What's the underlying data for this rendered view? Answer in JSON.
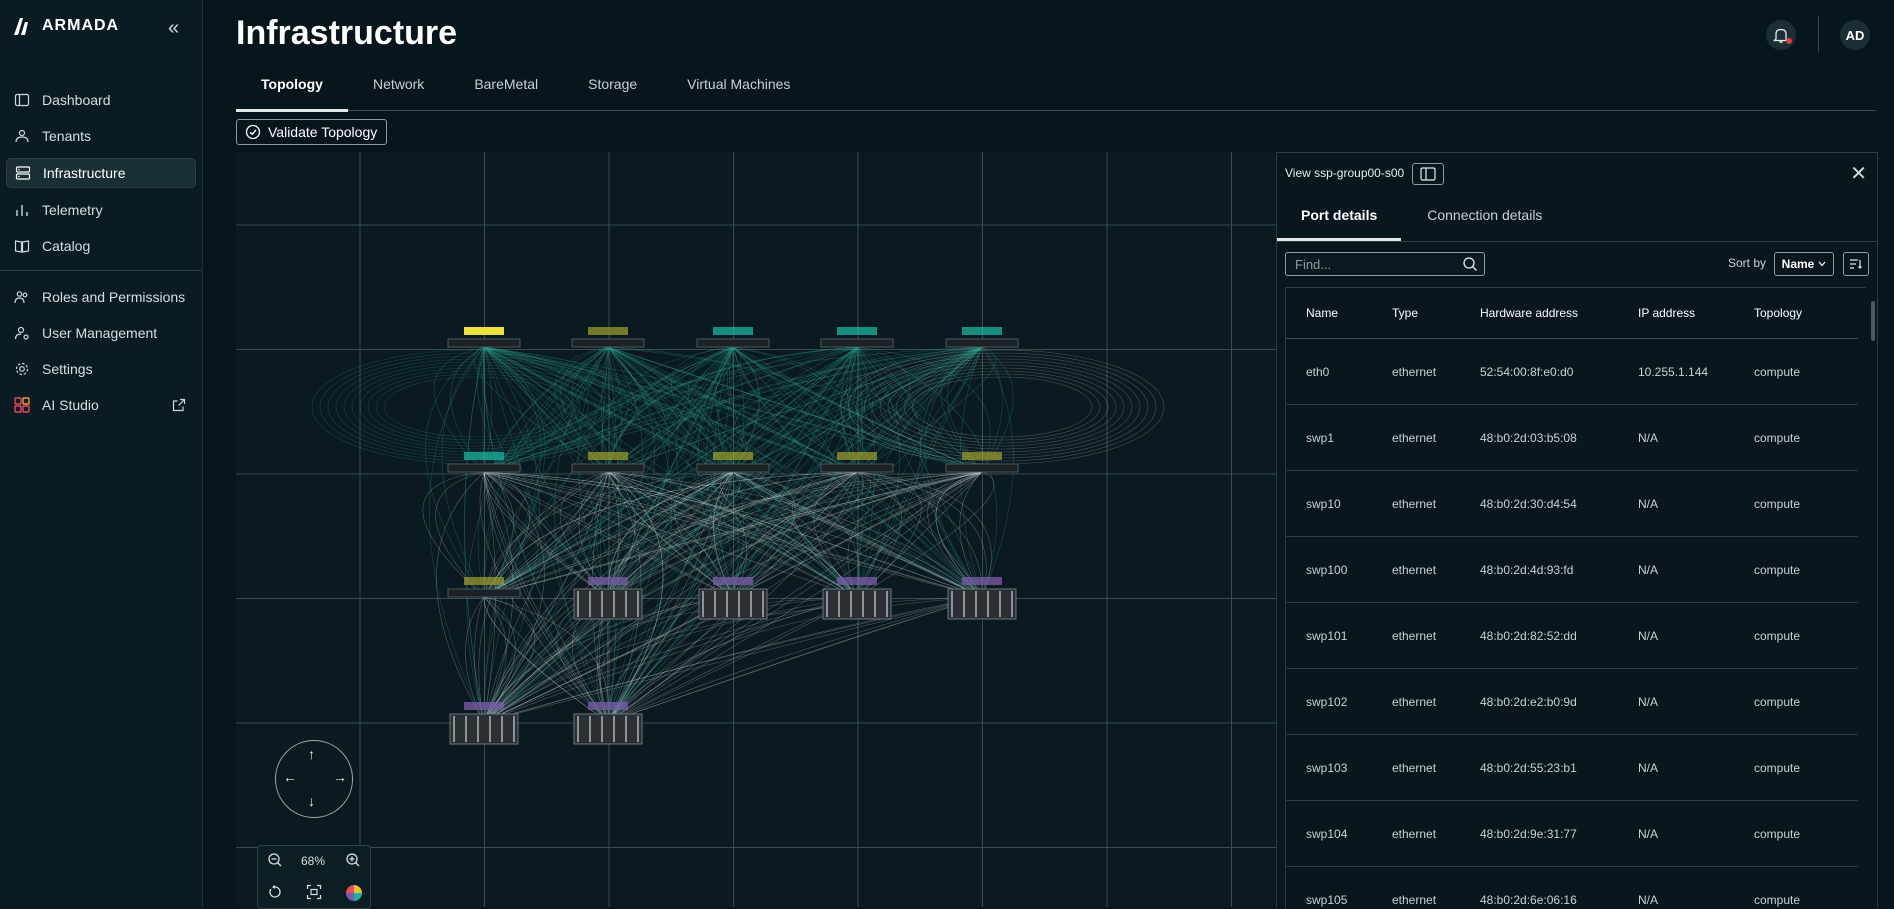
{
  "app": {
    "logo_text": "ARMADA"
  },
  "sidebar": {
    "items": [
      {
        "label": "Dashboard",
        "icon": "layout-icon"
      },
      {
        "label": "Tenants",
        "icon": "users-icon"
      },
      {
        "label": "Infrastructure",
        "icon": "server-icon",
        "active": true
      },
      {
        "label": "Telemetry",
        "icon": "bar-chart-icon"
      },
      {
        "label": "Catalog",
        "icon": "book-icon"
      }
    ],
    "items2": [
      {
        "label": "Roles and Permissions",
        "icon": "people-icon"
      },
      {
        "label": "User Management",
        "icon": "user-settings-icon"
      },
      {
        "label": "Settings",
        "icon": "gear-icon"
      },
      {
        "label": "AI Studio",
        "icon": "grid-icon",
        "external": true
      }
    ]
  },
  "header": {
    "title": "Infrastructure",
    "avatar": "AD"
  },
  "tabs": [
    "Topology",
    "Network",
    "BareMetal",
    "Storage",
    "Virtual Machines"
  ],
  "toolbar": {
    "validate_label": "Validate Topology"
  },
  "canvas": {
    "zoom": "68%"
  },
  "panel": {
    "title": "View ssp-group00-s00",
    "tabs": [
      "Port details",
      "Connection details"
    ],
    "find_placeholder": "Find...",
    "sort_label": "Sort by",
    "sort_value": "Name",
    "columns": [
      "Name",
      "Type",
      "Hardware address",
      "IP address",
      "Topology"
    ],
    "rows": [
      [
        "eth0",
        "ethernet",
        "52:54:00:8f:e0:d0",
        "10.255.1.144",
        "compute"
      ],
      [
        "swp1",
        "ethernet",
        "48:b0:2d:03:b5:08",
        "N/A",
        "compute"
      ],
      [
        "swp10",
        "ethernet",
        "48:b0:2d:30:d4:54",
        "N/A",
        "compute"
      ],
      [
        "swp100",
        "ethernet",
        "48:b0:2d:4d:93:fd",
        "N/A",
        "compute"
      ],
      [
        "swp101",
        "ethernet",
        "48:b0:2d:82:52:dd",
        "N/A",
        "compute"
      ],
      [
        "swp102",
        "ethernet",
        "48:b0:2d:e2:b0:9d",
        "N/A",
        "compute"
      ],
      [
        "swp103",
        "ethernet",
        "48:b0:2d:55:23:b1",
        "N/A",
        "compute"
      ],
      [
        "swp104",
        "ethernet",
        "48:b0:2d:9e:31:77",
        "N/A",
        "compute"
      ],
      [
        "swp105",
        "ethernet",
        "48:b0:2d:6e:06:16",
        "N/A",
        "compute"
      ]
    ]
  },
  "colors": {
    "background": "#06161c",
    "canvas": "#0b1a20",
    "edge_teal": "#2fa596",
    "edge_white": "#c9d3d6",
    "node_yellow": "#e8e23a",
    "node_olive": "#9a9a2f",
    "node_teal": "#19b5a0",
    "node_purple": "#7c5ea8",
    "alert_dot": "#e53935"
  }
}
